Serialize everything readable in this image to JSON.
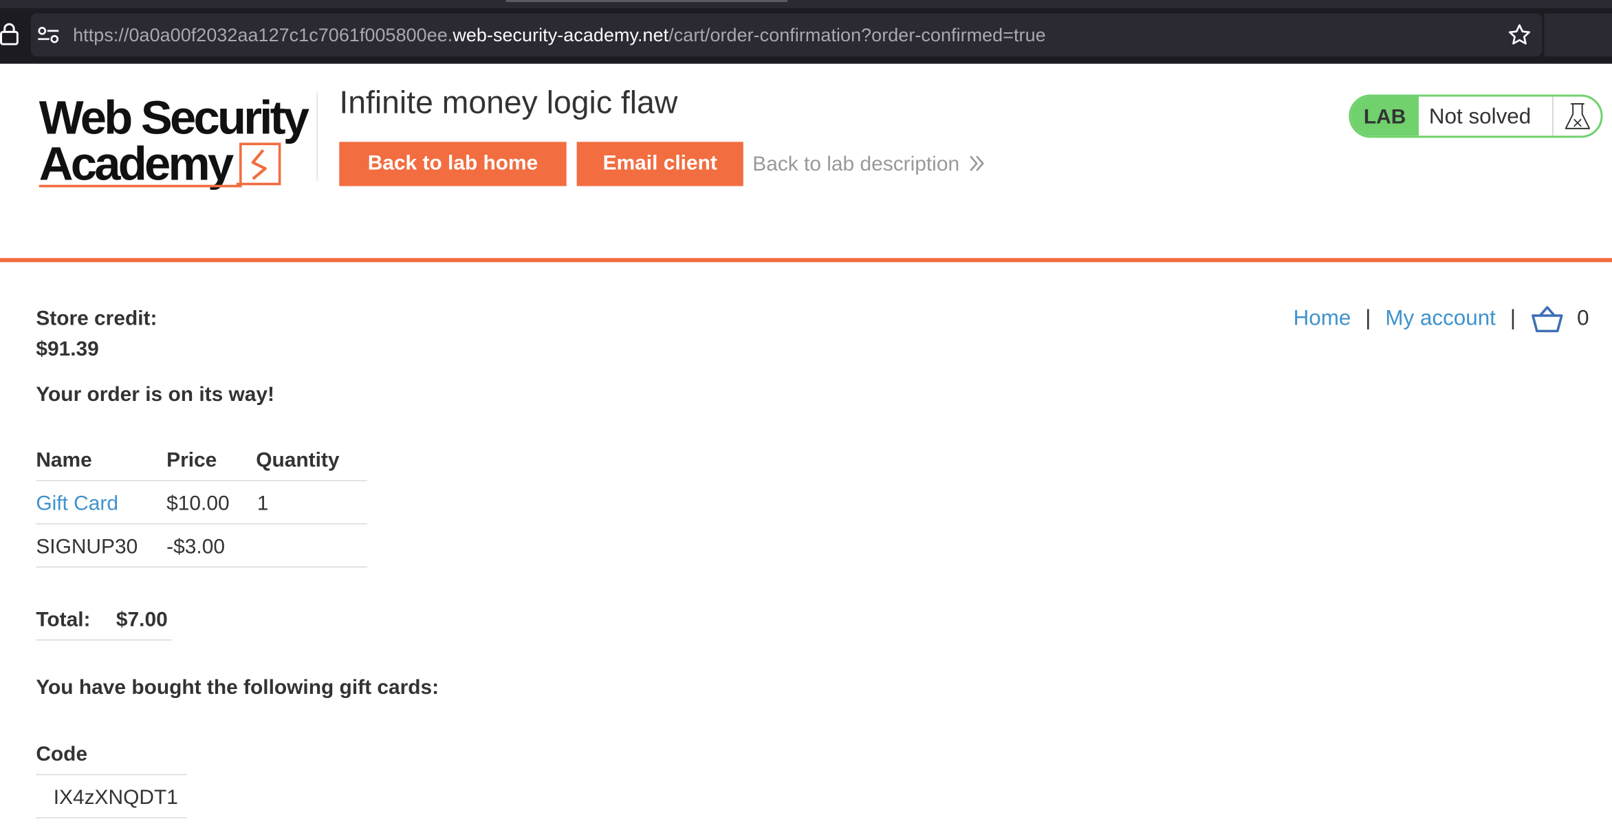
{
  "browser": {
    "url_prefix": "https://0a0a00f2032aa127c1c7061f005800ee.",
    "url_domain": "web-security-academy.net",
    "url_path": "/cart/order-confirmation?order-confirmed=true"
  },
  "header": {
    "logo_line1": "Web Security",
    "logo_line2": "Academy",
    "lab_title": "Infinite money logic flaw",
    "back_home_label": "Back to lab home",
    "email_client_label": "Email client",
    "back_description_label": "Back to lab description",
    "lab_badge_label": "LAB",
    "lab_status": "Not solved"
  },
  "nav": {
    "home": "Home",
    "separator": "|",
    "my_account": "My account",
    "cart_count": "0"
  },
  "store": {
    "credit_label": "Store credit:",
    "credit_value": "$91.39",
    "order_message": "Your order is on its way!",
    "table_headers": [
      "Name",
      "Price",
      "Quantity"
    ],
    "rows": [
      {
        "name": "Gift Card",
        "price": "$10.00",
        "quantity": "1"
      },
      {
        "name": "SIGNUP30",
        "price": "-$3.00",
        "quantity": ""
      }
    ],
    "total_label": "Total:",
    "total_value": "$7.00",
    "gift_cards_message": "You have bought the following gift cards:",
    "code_header": "Code",
    "codes": [
      "IX4zXNQDT1"
    ]
  },
  "colors": {
    "accent": "#f26d40",
    "link": "#3f92cc",
    "lab_green": "#70d16d"
  }
}
